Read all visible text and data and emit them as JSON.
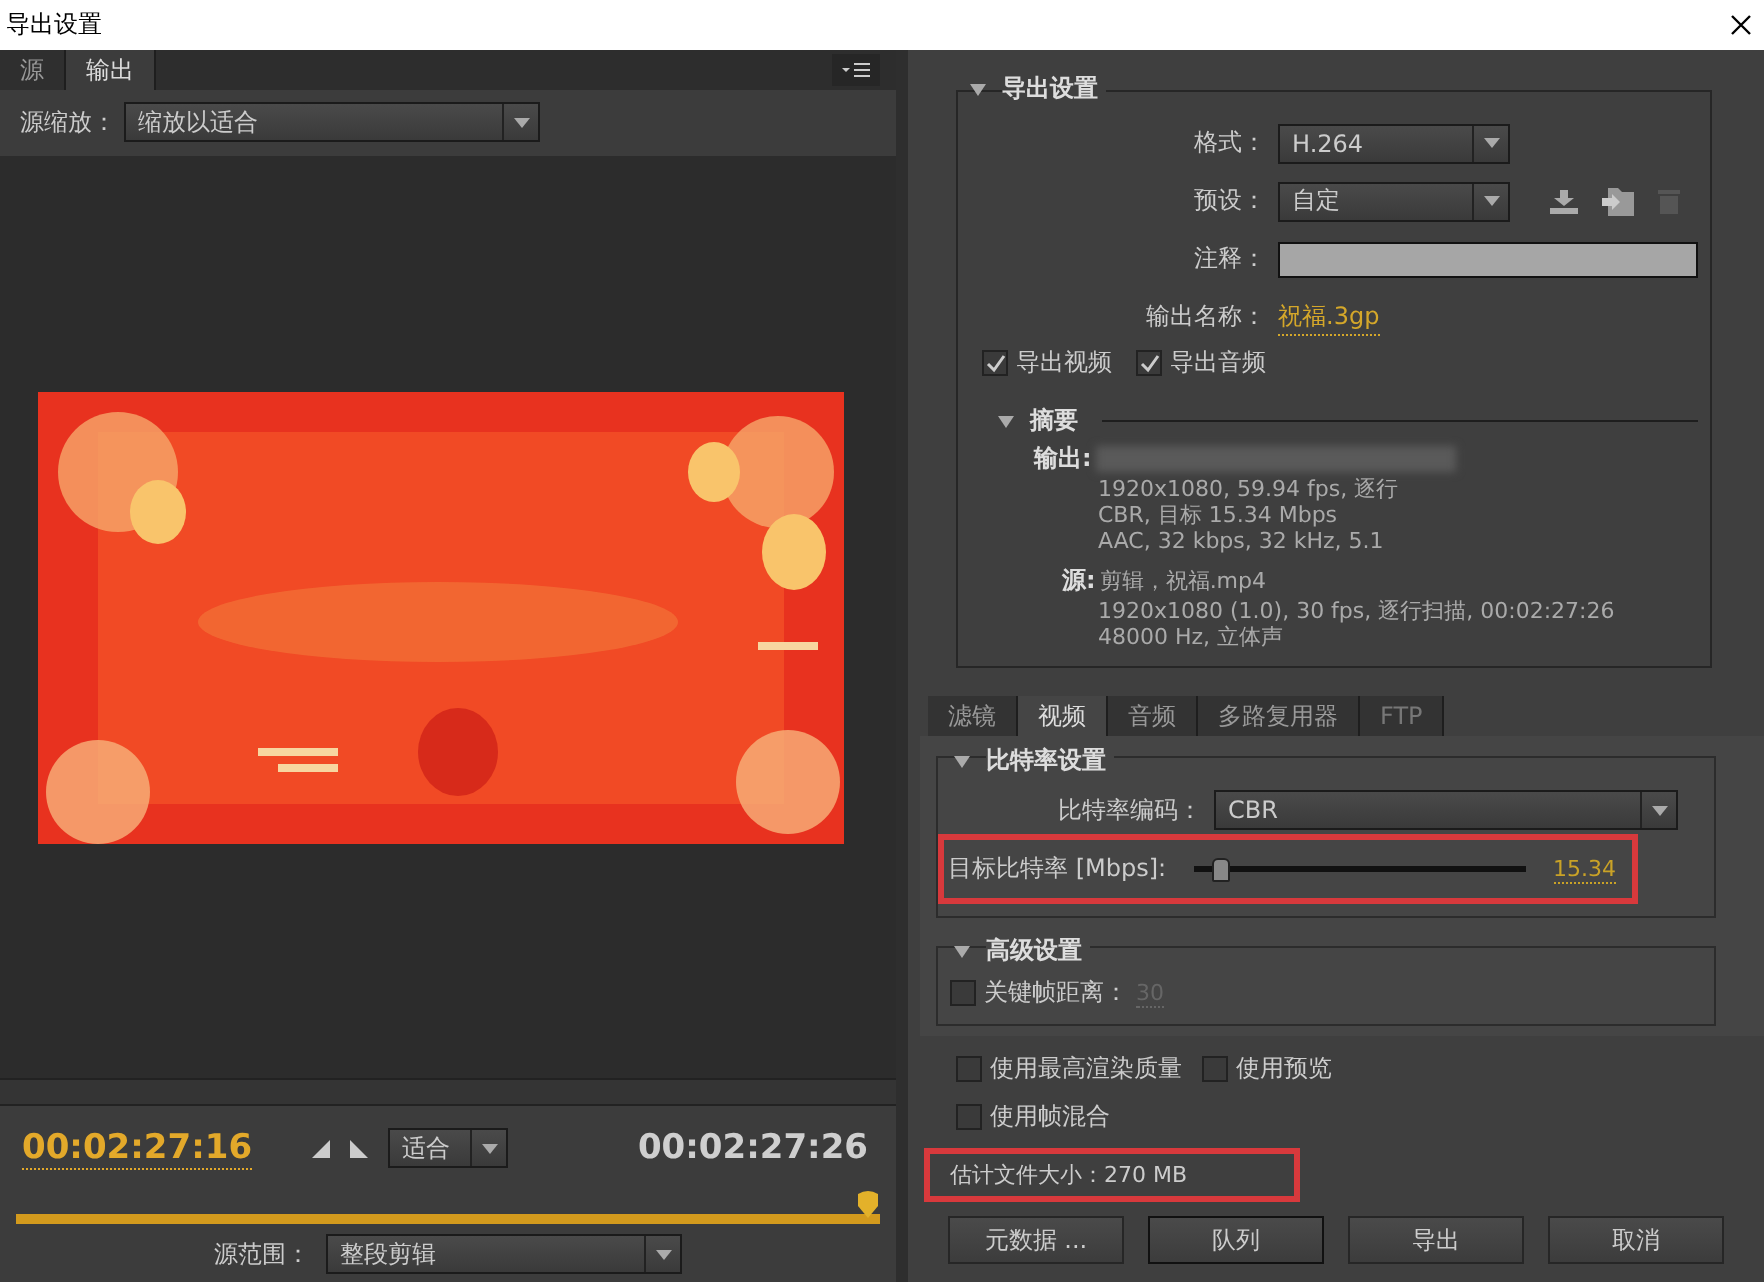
{
  "window": {
    "title": "导出设置"
  },
  "source_tabs": [
    {
      "label": "源",
      "selected": false
    },
    {
      "label": "输出",
      "selected": true
    }
  ],
  "source_scale": {
    "label": "源缩放：",
    "value": "缩放以适合"
  },
  "time": {
    "current": "00:02:27:16",
    "zoom": "适合",
    "duration": "00:02:27:26"
  },
  "timeline": {
    "level": 1
  },
  "source_range": {
    "label": "源范围：",
    "value": "整段剪辑"
  },
  "export_settings": {
    "title": "导出设置",
    "fields": [
      {
        "kind": "select",
        "label": "格式：",
        "value": "H.264"
      },
      {
        "kind": "preset",
        "label": "预设：",
        "value": "自定"
      },
      {
        "kind": "input",
        "label": "注释："
      },
      {
        "kind": "link",
        "label": "输出名称：",
        "value": "祝福.3gp"
      }
    ],
    "checkboxes": [
      {
        "label": "导出视频",
        "checked": true
      },
      {
        "label": "导出音频",
        "checked": true
      }
    ]
  },
  "summary": {
    "title": "摘要",
    "output_label": "输出:",
    "output_lines": [
      "1920x1080, 59.94 fps, 逐行",
      "CBR, 目标  15.34 Mbps",
      "AAC, 32 kbps, 32 kHz, 5.1"
    ],
    "source_label": "源:",
    "source_name": "剪辑，祝福.mp4",
    "source_lines": [
      "1920x1080 (1.0), 30 fps, 逐行扫描, 00:02:27:26",
      "48000 Hz, 立体声"
    ]
  },
  "settings_tabs": [
    {
      "label": "滤镜",
      "selected": false,
      "disabled": false
    },
    {
      "label": "视频",
      "selected": true,
      "disabled": false
    },
    {
      "label": "音频",
      "selected": false,
      "disabled": false
    },
    {
      "label": "多路复用器",
      "selected": false,
      "disabled": false
    },
    {
      "label": "FTP",
      "selected": false,
      "disabled": true
    }
  ],
  "bitrate": {
    "title": "比特率设置",
    "encoding_label": "比特率编码：",
    "encoding": "CBR",
    "target_label": "目标比特率 [Mbps]:",
    "level": 0.05,
    "reading": "15.34"
  },
  "advanced": {
    "title": "高级设置",
    "keyframe_label": "关键帧距离：",
    "keyframe_value": "30",
    "checked": false
  },
  "options": [
    {
      "label": "使用最高渲染质量",
      "checked": false
    },
    {
      "label": "使用预览",
      "checked": false
    },
    {
      "label": "使用帧混合",
      "checked": false
    }
  ],
  "estimate": "估计文件大小：270 MB",
  "buttons": [
    "元数据 ...",
    "队列",
    "导出",
    "取消"
  ]
}
